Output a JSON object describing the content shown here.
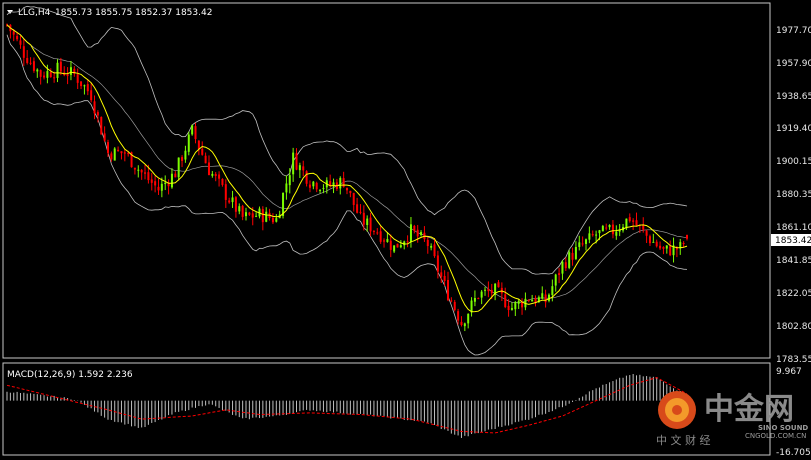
{
  "header": {
    "symbol_label": "LLG,H4",
    "ohlc": "1855.73 1855.75 1852.37 1853.42"
  },
  "price_axis": {
    "ticks": [
      "1977.70",
      "1957.90",
      "1938.65",
      "1919.40",
      "1900.15",
      "1880.35",
      "1861.10",
      "1841.85",
      "1822.05",
      "1802.80",
      "1783.55"
    ],
    "current_price": "1853.42"
  },
  "macd": {
    "label": "MACD(12,26,9) 1.592 2.236",
    "axis_max": "9.967",
    "axis_min": "-16.705"
  },
  "watermark": {
    "brand": "中金网",
    "sub_cn": "中 文 财 经",
    "sino": "SINO SOUND",
    "site": "CNGOLD.COM.CN",
    "ring": "ⓞ"
  },
  "colors": {
    "background": "#000000",
    "bull": "#7CFC00",
    "bear": "#ff0000",
    "ma": "#ffff00",
    "bands": "#c0c0c0",
    "signal": "#ff0000",
    "histogram": "#c0c0c0",
    "text": "#ffffff"
  },
  "chart_data": {
    "type": "candlestick",
    "timeframe": "H4",
    "ylim": [
      1783.55,
      1986
    ],
    "close_path_key_points": [
      [
        0,
        1982
      ],
      [
        5,
        1965
      ],
      [
        10,
        1952
      ],
      [
        15,
        1955
      ],
      [
        20,
        1952
      ],
      [
        25,
        1940
      ],
      [
        30,
        1905
      ],
      [
        35,
        1905
      ],
      [
        40,
        1893
      ],
      [
        45,
        1883
      ],
      [
        50,
        1893
      ],
      [
        55,
        1918
      ],
      [
        60,
        1895
      ],
      [
        65,
        1880
      ],
      [
        70,
        1866
      ],
      [
        75,
        1868
      ],
      [
        80,
        1865
      ],
      [
        85,
        1902
      ],
      [
        90,
        1888
      ],
      [
        95,
        1885
      ],
      [
        100,
        1888
      ],
      [
        105,
        1865
      ],
      [
        110,
        1858
      ],
      [
        115,
        1848
      ],
      [
        120,
        1858
      ],
      [
        125,
        1850
      ],
      [
        130,
        1825
      ],
      [
        135,
        1803
      ],
      [
        140,
        1820
      ],
      [
        145,
        1822
      ],
      [
        150,
        1812
      ],
      [
        155,
        1818
      ],
      [
        160,
        1816
      ],
      [
        165,
        1838
      ],
      [
        170,
        1848
      ],
      [
        175,
        1856
      ],
      [
        180,
        1858
      ],
      [
        185,
        1866
      ],
      [
        190,
        1855
      ],
      [
        195,
        1846
      ],
      [
        200,
        1848
      ],
      [
        202,
        1853.42
      ]
    ],
    "macd": {
      "ylim": [
        -16.705,
        9.967
      ],
      "histogram_key_points": [
        [
          0,
          3
        ],
        [
          20,
          0.5
        ],
        [
          30,
          -6
        ],
        [
          40,
          -9
        ],
        [
          50,
          -4
        ],
        [
          60,
          -1
        ],
        [
          70,
          -6
        ],
        [
          80,
          -5
        ],
        [
          90,
          -3
        ],
        [
          100,
          -4
        ],
        [
          110,
          -5
        ],
        [
          125,
          -7
        ],
        [
          135,
          -12
        ],
        [
          145,
          -9
        ],
        [
          155,
          -6
        ],
        [
          165,
          -2
        ],
        [
          175,
          4
        ],
        [
          185,
          8.5
        ],
        [
          193,
          7.5
        ],
        [
          202,
          1.6
        ]
      ],
      "signal_key_points": [
        [
          0,
          5
        ],
        [
          15,
          1
        ],
        [
          30,
          -3
        ],
        [
          40,
          -6
        ],
        [
          55,
          -5
        ],
        [
          65,
          -3
        ],
        [
          75,
          -4.5
        ],
        [
          90,
          -4
        ],
        [
          105,
          -4.5
        ],
        [
          120,
          -6
        ],
        [
          135,
          -10
        ],
        [
          145,
          -10.5
        ],
        [
          155,
          -8
        ],
        [
          165,
          -5
        ],
        [
          175,
          0
        ],
        [
          185,
          5
        ],
        [
          193,
          7.5
        ],
        [
          202,
          2.2
        ]
      ]
    }
  }
}
